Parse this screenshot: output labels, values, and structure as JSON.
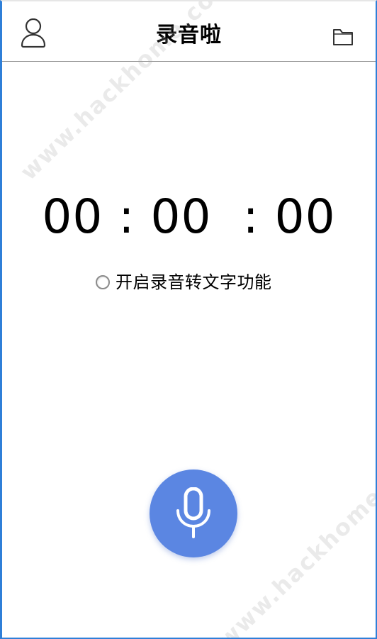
{
  "header": {
    "title": "录音啦",
    "left_icon": "user-icon",
    "right_icon": "folder-icon"
  },
  "timer": {
    "display": "00 : 00  : 00"
  },
  "transcription_toggle": {
    "label": "开启录音转文字功能",
    "checked": false
  },
  "record_button": {
    "icon": "microphone-icon"
  },
  "watermarks": [
    "www.hackhome.com",
    "www.hackhome.com"
  ],
  "colors": {
    "accent_blue": "#5b86e2",
    "frame_blue": "#2f7fd8",
    "divider": "#8a8a8a"
  }
}
